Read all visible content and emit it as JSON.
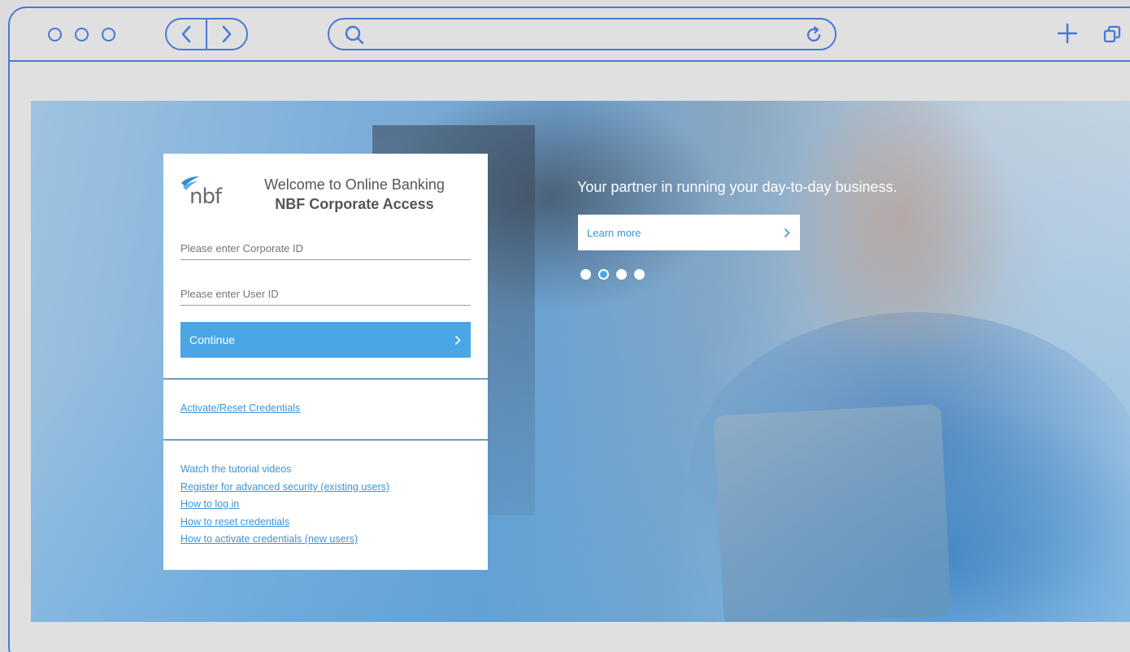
{
  "page": {
    "welcome_line1": "Welcome to Online Banking",
    "welcome_line2": "NBF Corporate Access",
    "logo_text": "nbf",
    "corporate_id_placeholder": "Please enter Corporate ID",
    "user_id_placeholder": "Please enter User ID",
    "continue_label": "Continue",
    "activate_link": "Activate/Reset Credentials",
    "tutorial_heading": "Watch the tutorial videos",
    "tutorial_links": [
      "Register for advanced security (existing users)",
      "How to log in",
      "How to reset credentials",
      "How to activate credentials (new users)"
    ],
    "tagline": "Your partner in running your day-to-day business.",
    "learn_more_label": "Learn more",
    "carousel_total": 4,
    "carousel_active_index": 1
  },
  "colors": {
    "accent": "#4aa6e4",
    "link": "#3d94d6",
    "browser_chrome": "#4a78d8"
  }
}
